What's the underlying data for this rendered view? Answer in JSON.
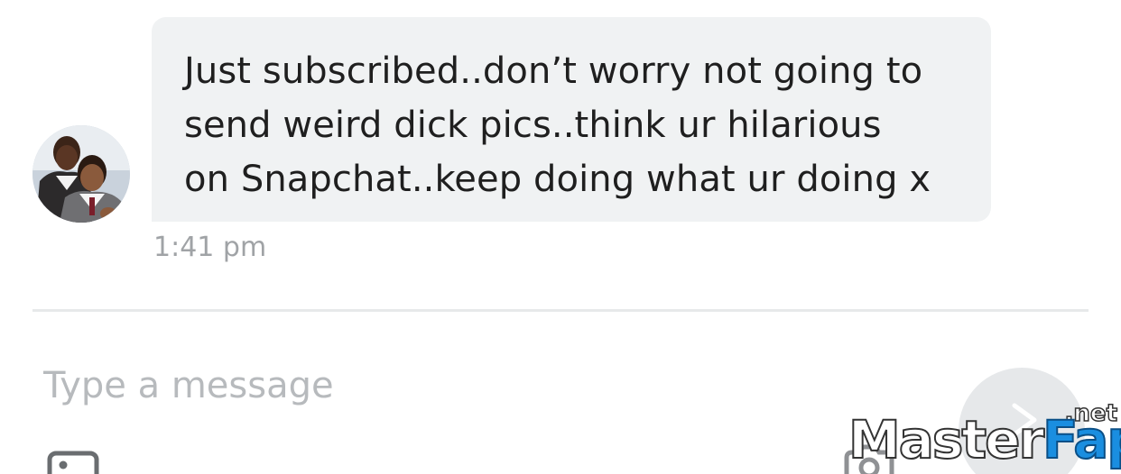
{
  "conversation": {
    "message": {
      "text": "Just subscribed..don’t worry not going to\nsend weird dick pics..think ur hilarious\non Snapchat..keep doing what ur doing x",
      "time": "1:41 pm"
    },
    "sender_avatar": "avatar-photo"
  },
  "composer": {
    "placeholder": "Type a message",
    "value": "",
    "attach_icon": "image-icon",
    "camera_icon": "camera-icon",
    "send_icon": "send-arrow-icon"
  },
  "watermark": {
    "brand": "MasterFap",
    "suffix": ".net"
  },
  "colors": {
    "bubble_background": "#f0f2f3",
    "message_text": "#1f1f1f",
    "timestamp": "#a0a3a6",
    "placeholder": "#b7babd",
    "divider": "#e7e9ea"
  }
}
